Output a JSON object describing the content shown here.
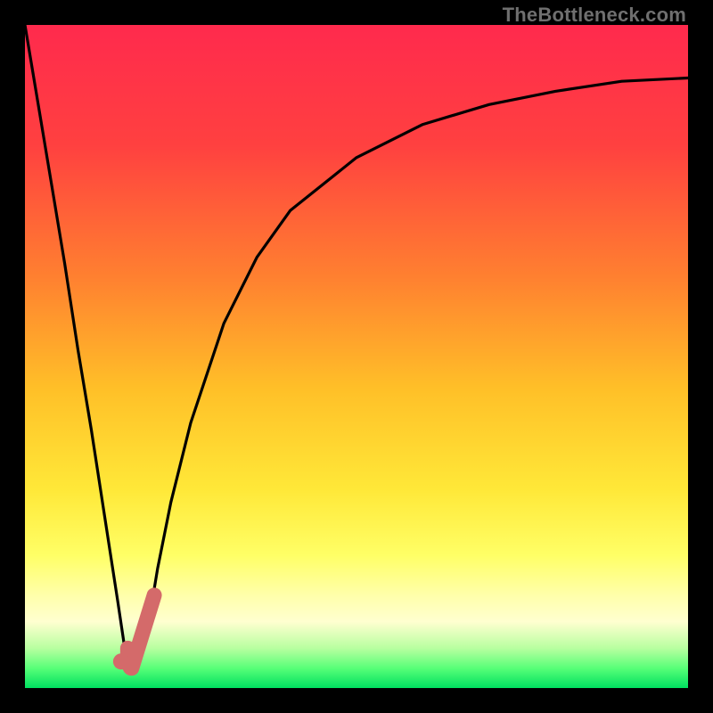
{
  "watermark": "TheBottleneck.com",
  "colors": {
    "gradient_stops": [
      {
        "offset": 0.0,
        "color": "#ff2a4d"
      },
      {
        "offset": 0.18,
        "color": "#ff4040"
      },
      {
        "offset": 0.38,
        "color": "#ff8030"
      },
      {
        "offset": 0.55,
        "color": "#ffc028"
      },
      {
        "offset": 0.7,
        "color": "#ffe838"
      },
      {
        "offset": 0.8,
        "color": "#ffff66"
      },
      {
        "offset": 0.86,
        "color": "#ffffaa"
      },
      {
        "offset": 0.9,
        "color": "#ffffd0"
      },
      {
        "offset": 0.94,
        "color": "#b8ffa0"
      },
      {
        "offset": 0.97,
        "color": "#58ff78"
      },
      {
        "offset": 1.0,
        "color": "#00e060"
      }
    ],
    "curve": "#000000",
    "marker": "#d46a6a",
    "frame": "#000000"
  },
  "chart_data": {
    "type": "line",
    "title": "",
    "xlabel": "",
    "ylabel": "",
    "ylim": [
      0,
      100
    ],
    "x": [
      0,
      2,
      4,
      6,
      8,
      10,
      12,
      14,
      15.5,
      17,
      18,
      19,
      20,
      22,
      25,
      30,
      35,
      40,
      50,
      60,
      70,
      80,
      90,
      100
    ],
    "values": [
      100,
      88,
      76,
      64,
      51,
      39,
      26,
      13,
      3,
      4,
      7,
      12,
      18,
      28,
      40,
      55,
      65,
      72,
      80,
      85,
      88,
      90,
      91.5,
      92
    ],
    "annotations": [
      {
        "kind": "marker-dot",
        "x": 14.5,
        "y": 4
      },
      {
        "kind": "marker-hook",
        "x_start": 15.5,
        "x_end": 19.5,
        "y_start": 3,
        "y_end": 14
      }
    ]
  }
}
